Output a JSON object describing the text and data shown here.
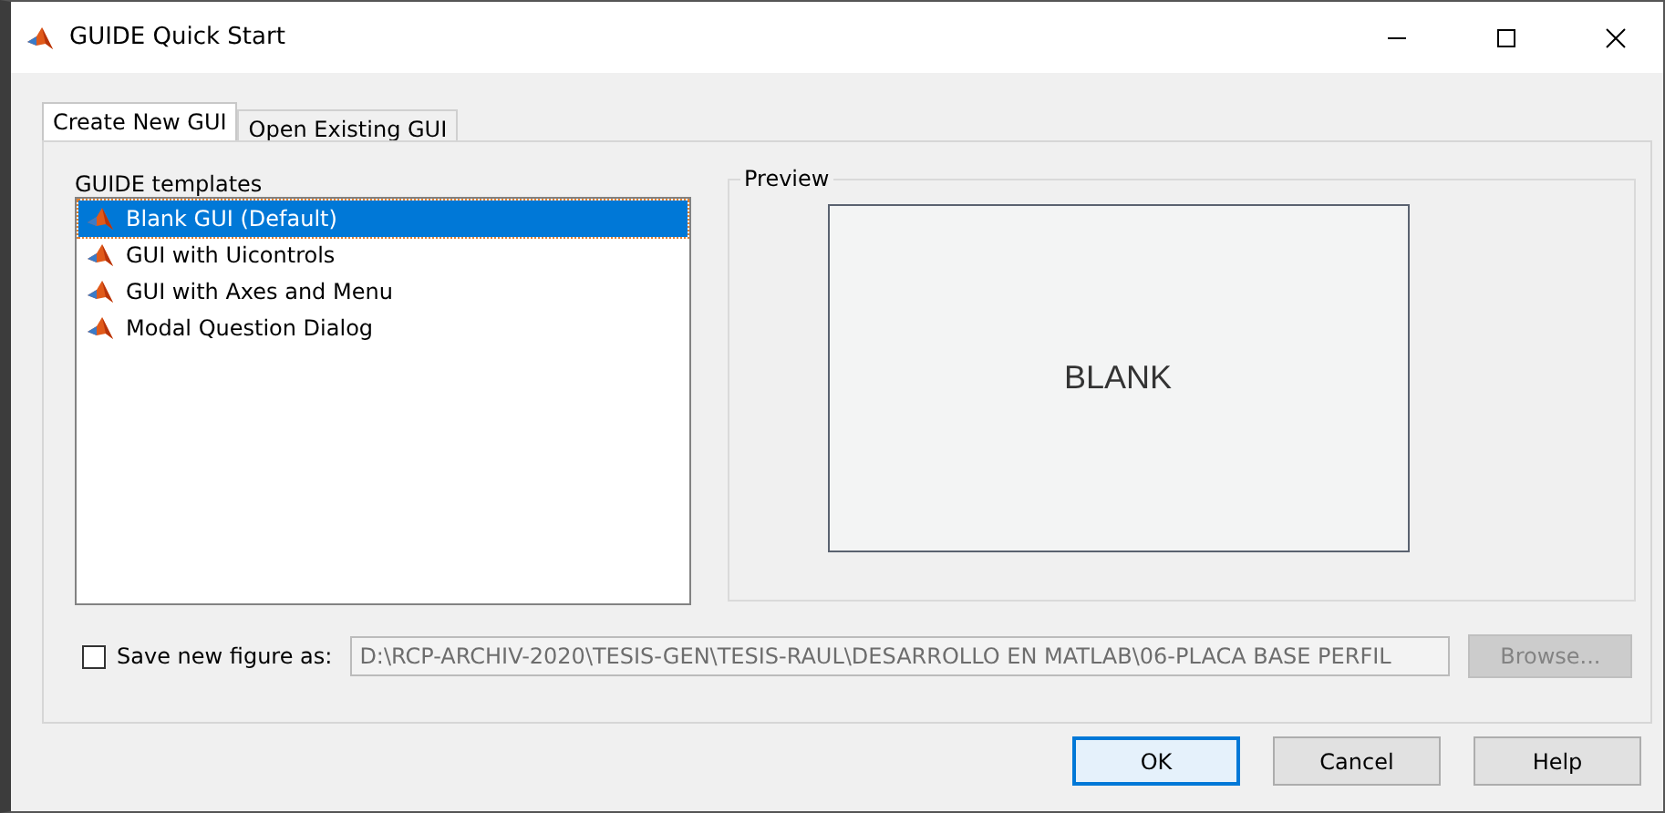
{
  "window": {
    "title": "GUIDE Quick Start"
  },
  "tabs": [
    {
      "label": "Create New GUI",
      "selected": true
    },
    {
      "label": "Open Existing GUI",
      "selected": false
    }
  ],
  "templates": {
    "label": "GUIDE templates",
    "items": [
      {
        "label": "Blank GUI (Default)",
        "selected": true
      },
      {
        "label": "GUI with Uicontrols",
        "selected": false
      },
      {
        "label": "GUI with Axes and Menu",
        "selected": false
      },
      {
        "label": "Modal Question Dialog",
        "selected": false
      }
    ]
  },
  "preview": {
    "label": "Preview",
    "text": "BLANK"
  },
  "save": {
    "label": "Save new figure as:",
    "checked": false,
    "path": "D:\\RCP-ARCHIV-2020\\TESIS-GEN\\TESIS-RAUL\\DESARROLLO EN MATLAB\\06-PLACA BASE PERFIL",
    "path_disabled": true,
    "browse": {
      "label": "Browse...",
      "disabled": true
    }
  },
  "buttons": [
    {
      "label": "OK",
      "default": true
    },
    {
      "label": "Cancel",
      "default": false
    },
    {
      "label": "Help",
      "default": false
    }
  ]
}
